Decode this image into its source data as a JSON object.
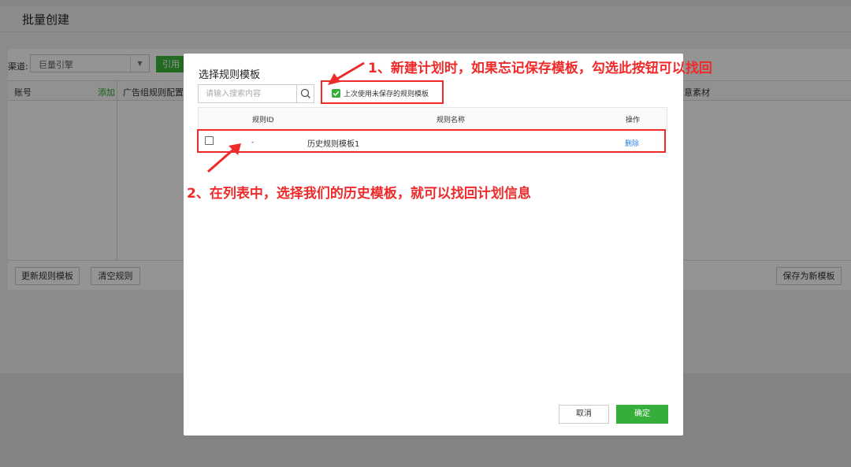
{
  "background": {
    "page_title": "批量创建",
    "channel_label": "渠道:",
    "channel_value": "巨量引擎",
    "cite_button": "引用",
    "columns": {
      "account": "账号",
      "add": "添加",
      "adgroup_config": "广告组规则配置",
      "material": "意素材"
    },
    "buttons": {
      "update_template": "更新规则模板",
      "clear_rules": "清空规则",
      "save_as_template": "保存为新模板"
    }
  },
  "modal": {
    "title": "选择规则模板",
    "search_placeholder": "请输入搜索内容",
    "unsaved_checkbox": {
      "label": "上次使用未保存的规则模板",
      "checked": true
    },
    "table": {
      "headers": {
        "id": "规则ID",
        "name": "规则名称",
        "operation": "操作"
      },
      "rows": [
        {
          "id": "-",
          "name": "历史规则模板1",
          "action": "删除",
          "selected": false
        }
      ]
    },
    "buttons": {
      "cancel": "取消",
      "confirm": "确定"
    }
  },
  "annotations": {
    "note_1": "1、新建计划时，如果忘记保存模板，勾选此按钮可以找回",
    "note_2": "2、在列表中，选择我们的历史模板，就可以找回计划信息"
  },
  "colors": {
    "accent_green": "#36ae3a",
    "annotation_red": "#ee2a2a",
    "link_blue": "#2e7fd8"
  }
}
